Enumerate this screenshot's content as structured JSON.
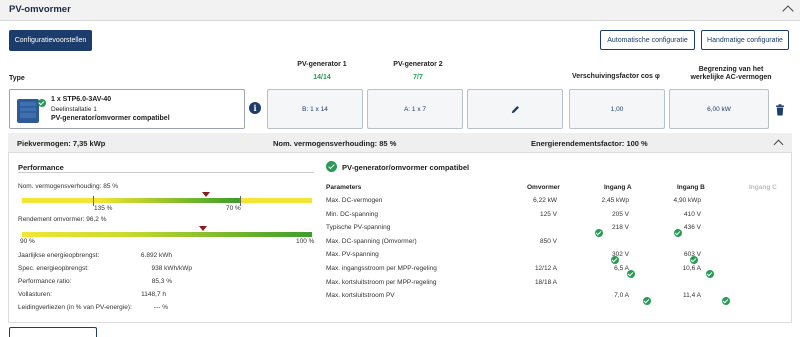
{
  "header": {
    "title": "PV-omvormer"
  },
  "buttons": {
    "config_proposals": "Configuratievoorstellen",
    "auto_config": "Automatische configuratie",
    "manual_config": "Handmatige configuratie"
  },
  "columns": {
    "type": "Type",
    "gen1": "PV-generator 1",
    "gen1_count": "14/14",
    "gen2": "PV-generator 2",
    "gen2_count": "7/7",
    "cosphi": "Verschuivingsfactor cos φ",
    "ac_limit_line1": "Begrenzing van het",
    "ac_limit_line2": "werkelijke AC-vermogen"
  },
  "inverter": {
    "model": "1 x STP6.0-3AV-40",
    "installation": "Deelinstallatie 1",
    "status": "PV-generator/omvormer compatibel"
  },
  "cells": {
    "gen1": "B: 1 x 14",
    "gen2": "A: 1 x 7",
    "cosphi": "1,00",
    "ac_limit": "6,00 kW"
  },
  "summary": {
    "peak": "Piekvermogen: 7,35 kWp",
    "ratio": "Nom. vermogensverhouding: 85 %",
    "efficiency": "Energierendementsfactor: 100 %"
  },
  "performance": {
    "title": "Performance",
    "ratio_label": "Nom. vermogensverhouding: 85 %",
    "ratio_marker": 0.85,
    "ratio_ticks": [
      "135 %",
      "70 %"
    ],
    "efficiency_label": "Rendement omvormer: 96,2 %",
    "efficiency_marker": 0.962,
    "efficiency_ticks": [
      "90 %",
      "100 %"
    ],
    "rows": [
      {
        "label": "Jaarlijkse energieopbrengst:",
        "value": "6.892 kWh"
      },
      {
        "label": "Spec. energieopbrengst:",
        "value": "938 kWh/kWp"
      },
      {
        "label": "Performance ratio:",
        "value": "85,3 %"
      },
      {
        "label": "Vollasturen:",
        "value": "1148,7 h"
      },
      {
        "label": "Leidingverliezen (in % van PV-energie):",
        "value": "--- %"
      }
    ]
  },
  "params": {
    "title": "PV-generator/omvormer compatibel",
    "headers": [
      "Parameters",
      "Omvormer",
      "Ingang A",
      "Ingang B",
      "Ingang C"
    ],
    "rows": [
      {
        "label": "Max. DC-vermogen",
        "inv": "6,22 kW",
        "a": "2,45 kWp",
        "b": "4,90 kWp",
        "a_ok": false,
        "b_ok": false
      },
      {
        "label": "Min. DC-spanning",
        "inv": "125 V",
        "a": "205 V",
        "b": "410 V",
        "a_ok": false,
        "b_ok": false
      },
      {
        "label": "Typische PV-spanning",
        "inv": "",
        "a": "218 V",
        "b": "436 V",
        "a_ok": true,
        "b_ok": true
      },
      {
        "label": "Max. DC-spanning (Omvormer)",
        "inv": "850 V",
        "a": "",
        "b": "",
        "a_ok": false,
        "b_ok": false
      },
      {
        "label": "Max. PV-spanning",
        "inv": "",
        "a": "302 V",
        "b": "603 V",
        "a_ok": true,
        "b_ok": true
      },
      {
        "label": "Max. ingangsstroom per MPP-regeling",
        "inv": "12/12 A",
        "a": "6,5 A",
        "b": "10,6 A",
        "a_ok": true,
        "b_ok": true
      },
      {
        "label": "Max. kortsluitstroom per MPP-regeling",
        "inv": "18/18 A",
        "a": "",
        "b": "",
        "a_ok": false,
        "b_ok": false
      },
      {
        "label": "Max. kortsluitstroom PV",
        "inv": "",
        "a": "7,0 A",
        "b": "11,4 A",
        "a_ok": true,
        "b_ok": true
      }
    ]
  },
  "icons": {
    "header_chevron": "chevron-up-icon",
    "info": "info-icon",
    "edit": "pencil-icon",
    "delete": "trash-icon",
    "summary_chevron": "chevron-up-icon",
    "check": "check-circle-icon"
  },
  "colors": {
    "primary": "#1c3c6b",
    "ok_green": "#2a9a57",
    "marker": "#8a1c1c"
  }
}
